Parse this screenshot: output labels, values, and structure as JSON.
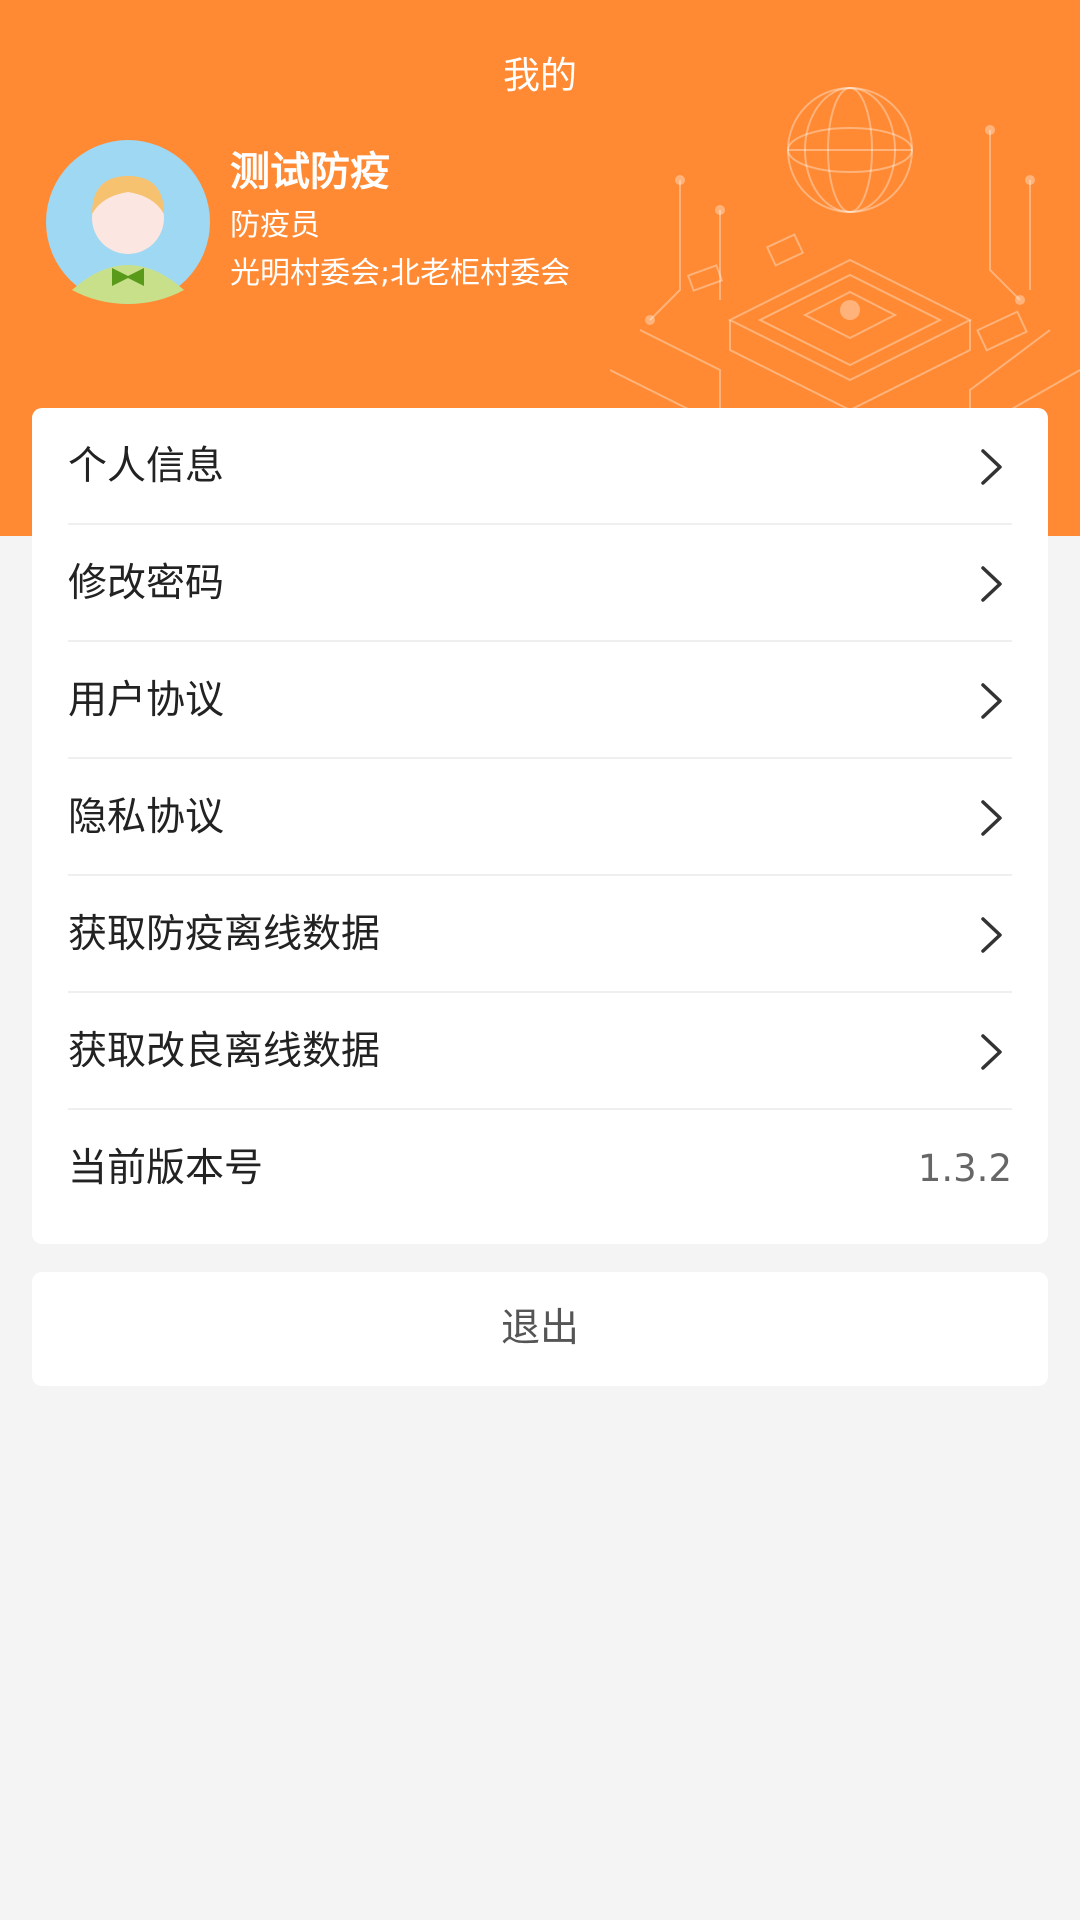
{
  "header": {
    "title": "我的",
    "user": {
      "name": "测试防疫",
      "role": "防疫员",
      "org": "光明村委会;北老柜村委会"
    },
    "colors": {
      "primary": "#ff8a33"
    }
  },
  "menu": {
    "items": [
      {
        "label": "个人信息"
      },
      {
        "label": "修改密码"
      },
      {
        "label": "用户协议"
      },
      {
        "label": "隐私协议"
      },
      {
        "label": "获取防疫离线数据"
      },
      {
        "label": "获取改良离线数据"
      }
    ],
    "version": {
      "label": "当前版本号",
      "value": "1.3.2"
    }
  },
  "logout_label": "退出",
  "icons": [
    "avatar",
    "chevron-right-icon",
    "tech-decoration"
  ]
}
